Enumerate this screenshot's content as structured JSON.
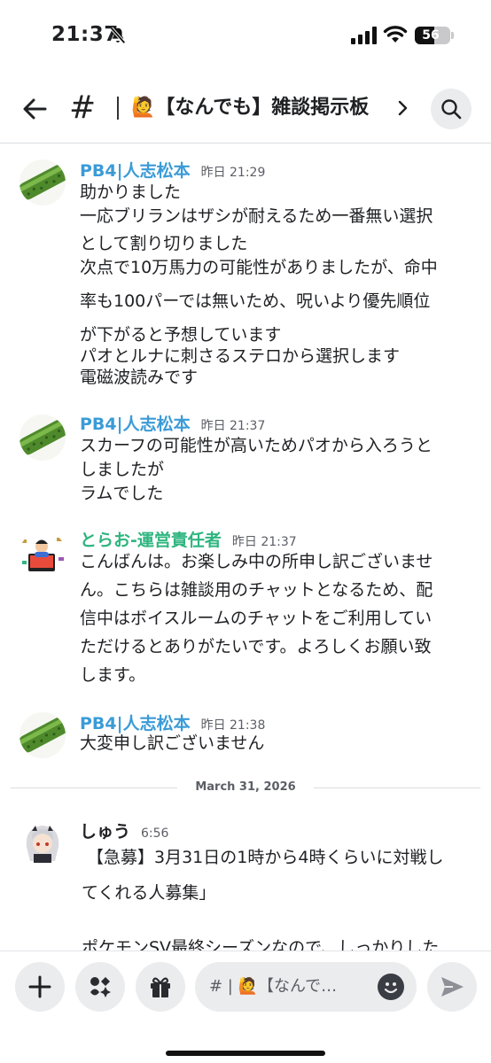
{
  "status_bar": {
    "time": "21:37",
    "battery_level": "56",
    "battery_fraction": 0.56,
    "icons": [
      "bell-slash-icon",
      "signal-icon",
      "wifi-icon",
      "battery-icon"
    ]
  },
  "header": {
    "back_icon": "arrow-left-icon",
    "channel_hash": "#",
    "channel_title": "🙋【なんでも】雑談掲示板",
    "chevron_icon": "chevron-right-icon",
    "search_icon": "search-icon"
  },
  "messages": [
    {
      "author": "PB4|人志松本",
      "time": "昨日 21:29",
      "lines": [
        "助かりました",
        "一応ブリランはザシが耐えるため一番無い選択",
        "として割り切りました",
        "次点で10万馬力の可能性がありましたが、命中",
        "率も100パーでは無いため、呪いより優先順位",
        "が下がると予想しています",
        "パオとルナに刺さるステロから選択します",
        "電磁波読みです"
      ]
    },
    {
      "author": "PB4|人志松本",
      "time": "昨日 21:37",
      "lines": [
        "スカーフの可能性が高いためパオから入ろうと",
        "しましたが",
        "ラムでした"
      ]
    },
    {
      "author": "とらお-運営責任者",
      "time": "昨日 21:37",
      "lines": [
        "こんばんは。お楽しみ中の所申し訳ございませ",
        "ん。こちらは雑談用のチャットとなるため、配",
        "信中はボイスルームのチャットをご利用してい",
        "ただけるとありがたいです。よろしくお願い致",
        "します。"
      ]
    },
    {
      "author": "PB4|人志松本",
      "time": "昨日 21:38",
      "lines": [
        "大変申し訳ございません"
      ]
    },
    {
      "author": "しゅう",
      "time": "6:56",
      "lines": [
        "【急募】3月31日の1時から4時くらいに対戦し",
        "てくれる人募集」",
        "",
        "ポケモンSV最終シーズンなので、しっかりした"
      ]
    }
  ],
  "date_divider": "March 31, 2026",
  "composer": {
    "placeholder": "# | 🙋【なんで…",
    "buttons": [
      "plus-icon",
      "apps-icon",
      "gift-icon",
      "emoji-icon",
      "send-icon"
    ]
  },
  "colors": {
    "author_blue": "#3a9bd7",
    "author_green": "#2fb57f",
    "button_bg": "#ebecee",
    "text": "#1f2023",
    "muted": "#5c5e66"
  }
}
